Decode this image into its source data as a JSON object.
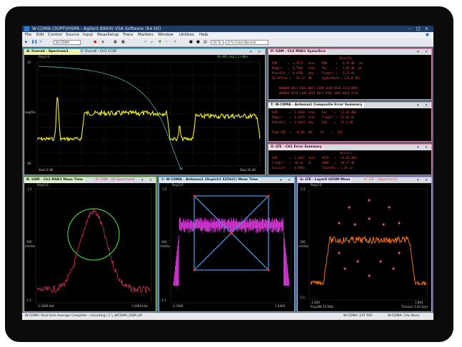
{
  "window": {
    "title": "W-CDMA (3GPP)/HSPA - Agilent 89600 VSA Software (64 bit)",
    "minimize": "–",
    "maximize": "□",
    "close": "×"
  },
  "menu": [
    "File",
    "Edit",
    "Control",
    "Source",
    "Input",
    "MeasSetup",
    "Trace",
    "Markers",
    "Window",
    "Utilities",
    "Help"
  ],
  "toolbar": {
    "measurement": "W-CDMA",
    "field1": "50 %",
    "field2": "0 %  Color Normal"
  },
  "panels": {
    "top_left": {
      "tabs": [
        "A: Overall - Spectrum1",
        "E: Overall - CH1 CCDF"
      ],
      "readout_left": "Rng 0  0",
      "readout_right": "Pts 801  (log 1 1) dBm",
      "y_top": "10",
      "y_mid": "Log/Div",
      "y_bottom": "-90",
      "x_left": "Start 0 dB",
      "x_right": "Stop 20 dB"
    },
    "gsm_syms": {
      "title": "P: GSM - Ch2 MSK1 Syms/Errs",
      "header": "Results",
      "lines": [
        "EVM      =  1.2571   %rms    RBW     =   4.35 dB  rms",
        "MagErr   =  0.7984   %rms    Pwr     =   3.05 dB  pk",
        "PhaseErr =  0.4188   deg     FreqErr =  -2.31 Hz",
        "IQ Offset =  -56.12  dB      SymbolRate = 270.8 kHz",
        "",
        "    000000 1011 0101 0011 1100 1010 0110 1111 0001",
        "    000040 0110 1100 1010 0011 0101 1001 0010 1110"
      ]
    },
    "wcdma_err": {
      "title": "T: W-CDMA - Antenna1 Composite Error Summary",
      "lines": [
        "EVM       =  1.3840  %rms    Pwr    =  -11.36 dBm",
        "MagErr    =  0.9215  %rms    FreqErr =  12.05 Hz",
        "PhaseErr  =  0.5642  deg     CDE    =  -41.2 dB",
        "",
        "Peak CDE  =  -39.88  dB     SF    =   256"
      ]
    },
    "lte_err": {
      "title": "X: LTE - CH1 Error Summary",
      "header": "Results",
      "lines": [
        "EVM       =  1.1022  %rms    RSTP   =  -24.81 dBm",
        "FreqErr   =  18.44   Hz      RSRQ   =  -10.77 dB",
        "SyncCorr  =  0.9981          TimeOffs = 1.44 us"
      ]
    },
    "bottom_left": {
      "tabs": [
        "B: GSM - Ch1 MSK1 Meas Time",
        "D: GSM - I/Q Spectrum1"
      ],
      "readout": "Rng 0  0",
      "y_top": "1.5",
      "y_mid1": "300",
      "y_mid2": "mV/div",
      "y_bottom": "-1.5",
      "x_left": "-1.5469 kHz",
      "x_right": "1.5469 kHz"
    },
    "bottom_mid": {
      "tabs": [
        "C: W-CDMA - Antenna1 1Scpich1 S256(C) Meas Time"
      ],
      "readout": "Rng 0  0",
      "y_top": "1.5",
      "y_mid1": "300",
      "y_mid2": "mV/div",
      "y_bottom": "-1.5",
      "x_left": "-1.5469",
      "x_right": "1.5469"
    },
    "bottom_right": {
      "tabs": [
        "G: LTE - Layer0 OFDM Meas",
        "H: LTE - I/Spectrum1"
      ],
      "readout": "Rng 0  0",
      "y_top": "1.5",
      "y_mid1": "300",
      "y_mid2": "mV/div",
      "y_bottom": "-1.5",
      "x_left": "-1.844",
      "x_right": "1.844",
      "x_sub_left": "Rng BW 10 MHz",
      "x_sub_right": "TimeLen 1.83 Sym"
    }
  },
  "status": {
    "left": "W-CDMA: Real time Average Complete - recording / C:\\_WCDMA_GSM.sdf",
    "mid": "W-CDMA: EXT REF",
    "right": "W-CDMA: CAL None"
  },
  "colors": {
    "spectrum_yellow": "#f2ef2a",
    "ccdf_teal": "#4ea0a0",
    "gsm_trace": "#c0304a",
    "gsm_circle": "#44c83a",
    "wcdma_magenta": "#f03cf0",
    "wcdma_blue": "#4a90d8",
    "lte_orange": "#f47020",
    "lte_const": "#e04a90",
    "err_text": "#e04a4a"
  }
}
